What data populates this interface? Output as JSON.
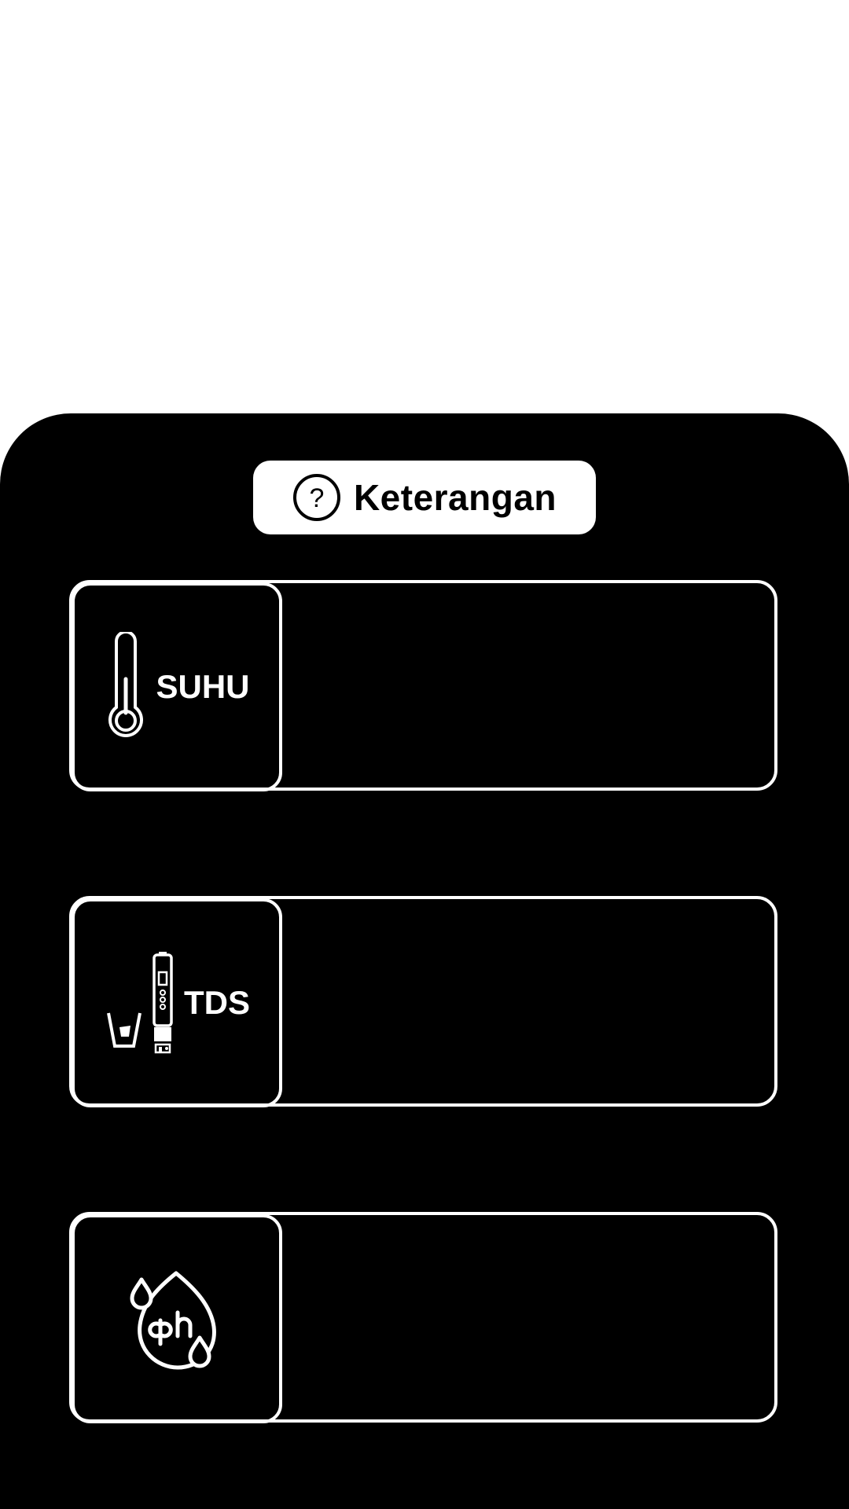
{
  "header": {
    "title": "Keterangan",
    "icon": "help-circle-icon"
  },
  "cards": [
    {
      "label": "SUHU",
      "icon": "thermometer-icon",
      "value": ""
    },
    {
      "label": "TDS",
      "icon": "tds-meter-icon",
      "value": ""
    },
    {
      "label": "",
      "icon": "ph-drop-icon",
      "value": ""
    }
  ],
  "colors": {
    "background": "#ffffff",
    "panel": "#000000",
    "accent": "#ffffff"
  }
}
